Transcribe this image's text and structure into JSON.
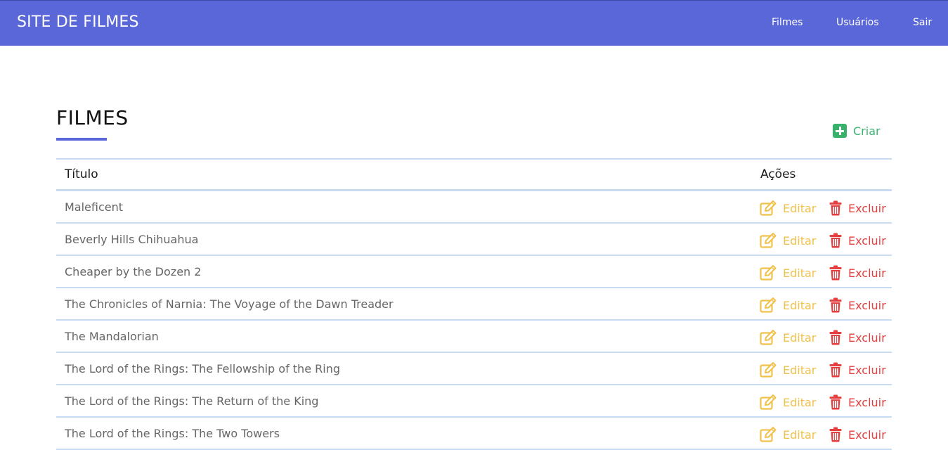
{
  "navbar": {
    "brand": "SITE DE FILMES",
    "links": [
      "Filmes",
      "Usuários",
      "Sair"
    ],
    "background": "#5a67d8"
  },
  "page": {
    "title": "FILMES",
    "create_label": "Criar",
    "create_icon": "plus-square-icon"
  },
  "table": {
    "headers": {
      "title": "Título",
      "actions": "Ações"
    },
    "edit_label": "Editar",
    "delete_label": "Excluir",
    "edit_icon": "edit-icon",
    "delete_icon": "trash-icon",
    "rows": [
      "Maleficent",
      "Beverly Hills Chihuahua",
      "Cheaper by the Dozen 2",
      "The Chronicles of Narnia: The Voyage of the Dawn Treader",
      "The Mandalorian",
      "The Lord of the Rings: The Fellowship of the Ring",
      "The Lord of the Rings: The Return of the King",
      "The Lord of the Rings: The Two Towers"
    ]
  },
  "colors": {
    "accent": "#5a67d8",
    "create": "#38b26b",
    "edit": "#f0c24b",
    "delete": "#e53e3e",
    "row_border": "#c7dcf0"
  }
}
